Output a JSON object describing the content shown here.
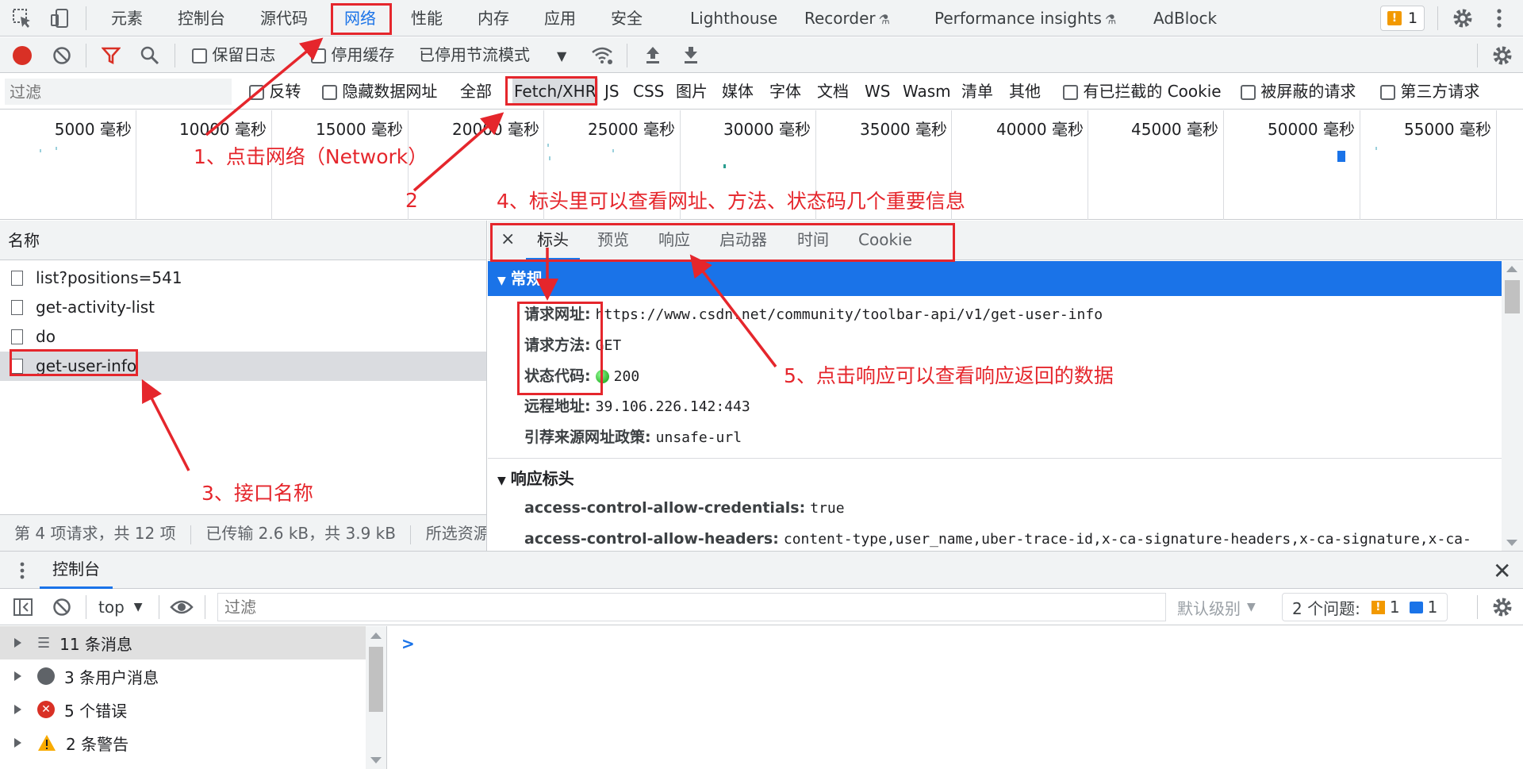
{
  "top_tabs": [
    "元素",
    "控制台",
    "源代码",
    "网络",
    "性能",
    "内存",
    "应用",
    "安全",
    "Lighthouse",
    "Recorder",
    "Performance insights",
    "AdBlock"
  ],
  "top_tabs_flask": [
    "Recorder",
    "Performance insights"
  ],
  "issues_badge": "1",
  "network_toolbar": {
    "preserve_log": "保留日志",
    "disable_cache": "停用缓存",
    "throttling": "已停用节流模式"
  },
  "filter_row": {
    "placeholder": "过滤",
    "invert": "反转",
    "hide_data_urls": "隐藏数据网址",
    "types": [
      "全部",
      "Fetch/XHR",
      "JS",
      "CSS",
      "图片",
      "媒体",
      "字体",
      "文档",
      "WS",
      "Wasm",
      "清单",
      "其他"
    ],
    "blocked_cookies": "有已拦截的 Cookie",
    "blocked_requests": "被屏蔽的请求",
    "third_party": "第三方请求"
  },
  "overview_ticks": [
    "5000 毫秒",
    "10000 毫秒",
    "15000 毫秒",
    "20000 毫秒",
    "25000 毫秒",
    "30000 毫秒",
    "35000 毫秒",
    "40000 毫秒",
    "45000 毫秒",
    "50000 毫秒",
    "55000 毫秒"
  ],
  "request_list": {
    "header": "名称",
    "items": [
      "list?positions=541",
      "get-activity-list",
      "do",
      "get-user-info"
    ],
    "selected_index": 3,
    "status": [
      "第 4 项请求，共 12 项",
      "已传输 2.6 kB，共 3.9 kB",
      "所选资源大"
    ]
  },
  "detail": {
    "close": "×",
    "tabs": [
      "标头",
      "预览",
      "响应",
      "启动器",
      "时间",
      "Cookie"
    ],
    "active_tab": "标头",
    "general_title": "常规",
    "general": [
      {
        "k": "请求网址:",
        "v": "https://www.csdn.net/community/toolbar-api/v1/get-user-info"
      },
      {
        "k": "请求方法:",
        "v": "GET"
      },
      {
        "k": "状态代码:",
        "v": "200"
      },
      {
        "k": "远程地址:",
        "v": "39.106.226.142:443"
      },
      {
        "k": "引荐来源网址政策:",
        "v": "unsafe-url"
      }
    ],
    "response_headers_title": "响应标头",
    "response_headers": [
      {
        "k": "access-control-allow-credentials:",
        "v": "true"
      },
      {
        "k": "access-control-allow-headers:",
        "v": "content-type,user_name,uber-trace-id,x-ca-signature-headers,x-ca-signature,x-ca-"
      }
    ]
  },
  "console": {
    "tab": "控制台",
    "context": "top",
    "filter_placeholder": "过滤",
    "level": "默认级别",
    "issues_label": "2 个问题:",
    "issues_warn": "1",
    "issues_info": "1",
    "sidebar": [
      "11 条消息",
      "3 条用户消息",
      "5 个错误",
      "2 条警告"
    ],
    "prompt": ">"
  },
  "annotations": {
    "a1": "1、点击网络（Network）",
    "a2": "2",
    "a3": "3、接口名称",
    "a4": "4、标头里可以查看网址、方法、状态码几个重要信息",
    "a5": "5、点击响应可以查看响应返回的数据"
  },
  "colors": {
    "accent": "#1a73e8",
    "annotation": "#e5262c",
    "record": "#d93025"
  }
}
